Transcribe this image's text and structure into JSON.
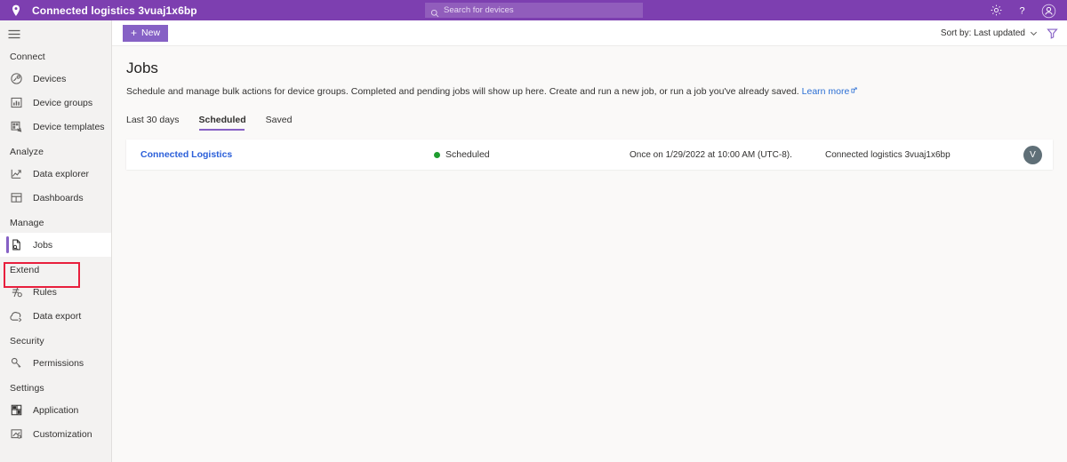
{
  "topbar": {
    "pin_icon": "location-pin-icon",
    "app_title": "Connected logistics 3vuaj1x6bp",
    "search": {
      "icon": "search-icon",
      "placeholder": "Search for devices",
      "value": ""
    },
    "settings_icon": "gear-icon",
    "help_icon": "question-mark-icon",
    "account_icon": "account-avatar-icon",
    "background_color": "#7d3fb0"
  },
  "sidebar": {
    "menu_toggle_icon": "hamburger-menu-icon",
    "selected_item": "Jobs",
    "highlight_color": "#e81f3d",
    "accent_color": "#8661c5",
    "groups": [
      {
        "label": "Connect",
        "items": [
          {
            "label": "Devices",
            "icon": "devices-icon",
            "selected": false
          },
          {
            "label": "Device groups",
            "icon": "device-groups-icon",
            "selected": false
          },
          {
            "label": "Device templates",
            "icon": "device-templates-icon",
            "selected": false
          }
        ]
      },
      {
        "label": "Analyze",
        "items": [
          {
            "label": "Data explorer",
            "icon": "data-explorer-icon",
            "selected": false
          },
          {
            "label": "Dashboards",
            "icon": "dashboards-icon",
            "selected": false
          }
        ]
      },
      {
        "label": "Manage",
        "items": [
          {
            "label": "Jobs",
            "icon": "jobs-icon",
            "selected": true
          }
        ]
      },
      {
        "label": "Extend",
        "items": [
          {
            "label": "Rules",
            "icon": "rules-icon",
            "selected": false
          },
          {
            "label": "Data export",
            "icon": "data-export-icon",
            "selected": false
          }
        ]
      },
      {
        "label": "Security",
        "items": [
          {
            "label": "Permissions",
            "icon": "permissions-key-icon",
            "selected": false
          }
        ]
      },
      {
        "label": "Settings",
        "items": [
          {
            "label": "Application",
            "icon": "application-icon",
            "selected": false
          },
          {
            "label": "Customization",
            "icon": "customization-icon",
            "selected": false
          }
        ]
      }
    ]
  },
  "commandbar": {
    "new_label": "New",
    "new_plus": "+",
    "sort_label": "Sort by: Last updated",
    "sort_chevron_icon": "chevron-down-icon",
    "filter_icon": "filter-funnel-icon"
  },
  "page": {
    "title": "Jobs",
    "description": "Schedule and manage bulk actions for device groups. Completed and pending jobs will show up here. Create and run a new job, or run a job you've already saved.",
    "learn_more_label": "Learn more",
    "learn_more_icon": "external-link-icon",
    "tabs": [
      {
        "label": "Last 30 days",
        "active": false
      },
      {
        "label": "Scheduled",
        "active": true
      },
      {
        "label": "Saved",
        "active": false
      }
    ]
  },
  "jobs": [
    {
      "name": "Connected Logistics",
      "status": "Scheduled",
      "status_color": "#1f9d2f",
      "schedule": "Once on 1/29/2022 at 10:00 AM (UTC-8).",
      "device_group": "Connected logistics 3vuaj1x6bp",
      "avatar_initial": "V"
    }
  ]
}
